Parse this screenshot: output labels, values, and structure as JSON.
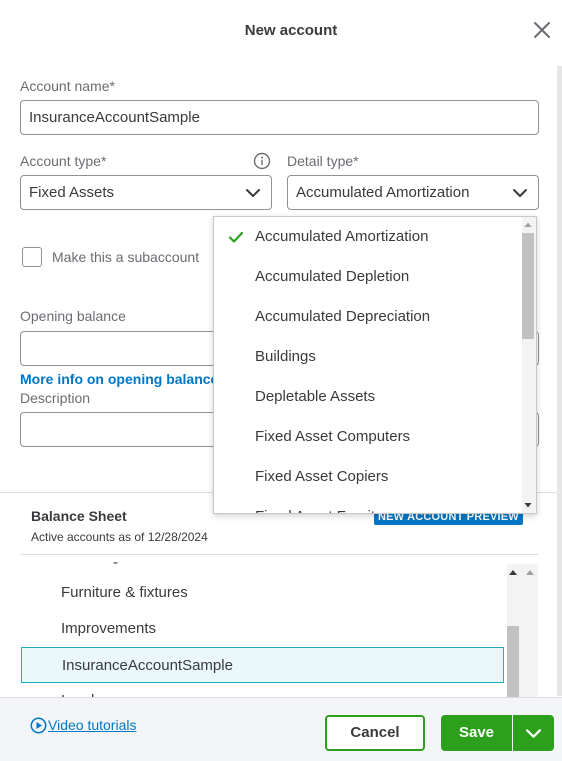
{
  "dialog": {
    "title": "New account"
  },
  "form": {
    "account_name_label": "Account name*",
    "account_name_value": "InsuranceAccountSample",
    "account_type_label": "Account type*",
    "account_type_value": "Fixed Assets",
    "detail_type_label": "Detail type*",
    "detail_type_value": "Accumulated Amortization",
    "subaccount_label": "Make this a subaccount",
    "subaccount_checked": false,
    "opening_balance_label": "Opening balance",
    "opening_balance_value": "",
    "opening_balance_link": "More info on opening balance",
    "description_label": "Description",
    "description_value": ""
  },
  "detail_type_dropdown": {
    "selected": "Accumulated Amortization",
    "options": [
      "Accumulated Amortization",
      "Accumulated Depletion",
      "Accumulated Depreciation",
      "Buildings",
      "Depletable Assets",
      "Fixed Asset Computers",
      "Fixed Asset Copiers",
      "Fixed Asset Furniture"
    ]
  },
  "balance_sheet": {
    "title": "Balance Sheet",
    "subtitle": "Active accounts as of 12/28/2024",
    "badge": "NEW ACCOUNT PREVIEW",
    "rows": [
      "-",
      "Furniture & fixtures",
      "Improvements",
      "InsuranceAccountSample",
      "Land"
    ],
    "selected_row": "InsuranceAccountSample"
  },
  "footer": {
    "video_link": "Video tutorials",
    "cancel_label": "Cancel",
    "save_label": "Save"
  },
  "colors": {
    "accent_green": "#2ca01c",
    "link_blue": "#0077c5",
    "highlight_teal": "#21abc5"
  }
}
